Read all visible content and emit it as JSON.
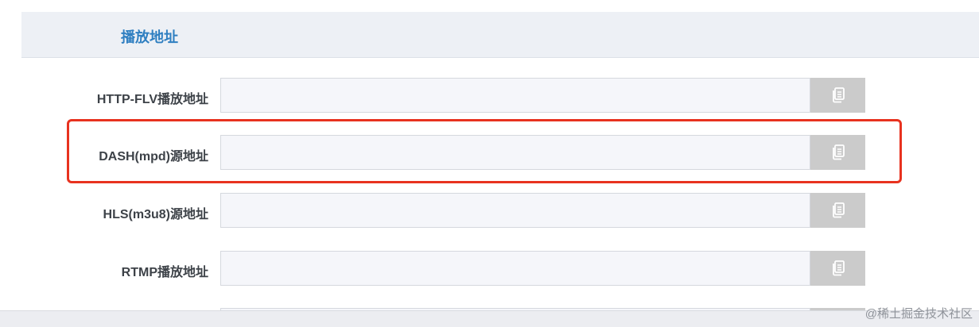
{
  "section": {
    "title": "播放地址"
  },
  "rows": [
    {
      "label": "HTTP-FLV播放地址",
      "value": "",
      "copy_icon": "copy-icon"
    },
    {
      "label": "DASH(mpd)源地址",
      "value": "",
      "copy_icon": "copy-icon"
    },
    {
      "label": "HLS(m3u8)源地址",
      "value": "",
      "copy_icon": "copy-icon"
    },
    {
      "label": "RTMP播放地址",
      "value": "",
      "copy_icon": "copy-icon"
    },
    {
      "label": "",
      "value": "",
      "copy_icon": ""
    }
  ],
  "annotation": {
    "color": "#e8321f",
    "highlighted_row": "DASH(mpd)源地址"
  },
  "watermark": {
    "text": "@稀土掘金技术社区"
  },
  "colors": {
    "accent": "#2f7fc1",
    "copy_button": "#cbcbcb",
    "header_bg": "#edf0f5"
  }
}
